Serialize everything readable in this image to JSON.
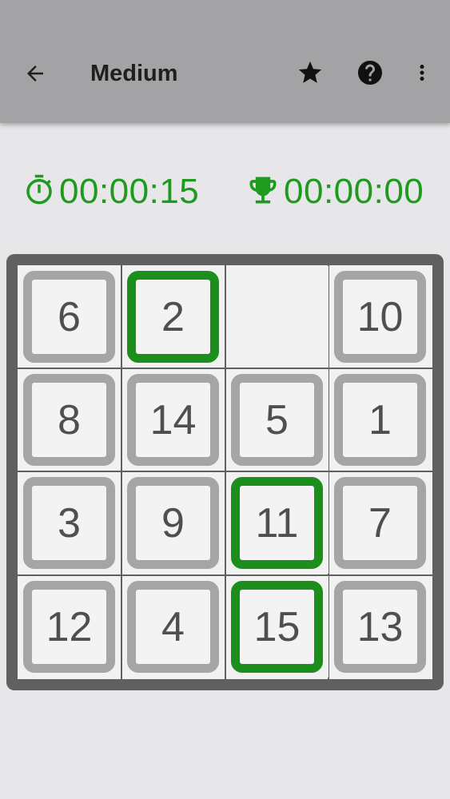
{
  "appbar": {
    "title": "Medium",
    "icons": [
      "back-arrow-icon",
      "star-icon",
      "help-icon",
      "more-vert-icon"
    ]
  },
  "timers": {
    "elapsed": "00:00:15",
    "best": "00:00:00",
    "elapsed_icon": "stopwatch-icon",
    "best_icon": "trophy-icon"
  },
  "board": {
    "rows": [
      [
        {
          "label": "6",
          "state": "gray"
        },
        {
          "label": "2",
          "state": "green"
        },
        {
          "label": "",
          "state": "empty"
        },
        {
          "label": "10",
          "state": "gray"
        }
      ],
      [
        {
          "label": "8",
          "state": "gray"
        },
        {
          "label": "14",
          "state": "gray"
        },
        {
          "label": "5",
          "state": "gray"
        },
        {
          "label": "1",
          "state": "gray"
        }
      ],
      [
        {
          "label": "3",
          "state": "gray"
        },
        {
          "label": "9",
          "state": "gray"
        },
        {
          "label": "11",
          "state": "green"
        },
        {
          "label": "7",
          "state": "gray"
        }
      ],
      [
        {
          "label": "12",
          "state": "gray"
        },
        {
          "label": "4",
          "state": "gray"
        },
        {
          "label": "15",
          "state": "green"
        },
        {
          "label": "13",
          "state": "gray"
        }
      ]
    ]
  },
  "colors": {
    "accent_green": "#1b8e1b",
    "timer_green": "#1e9a1e",
    "tile_border": "#a5a5a5",
    "board_frame": "#606060",
    "appbar": "#a3a3a5"
  }
}
